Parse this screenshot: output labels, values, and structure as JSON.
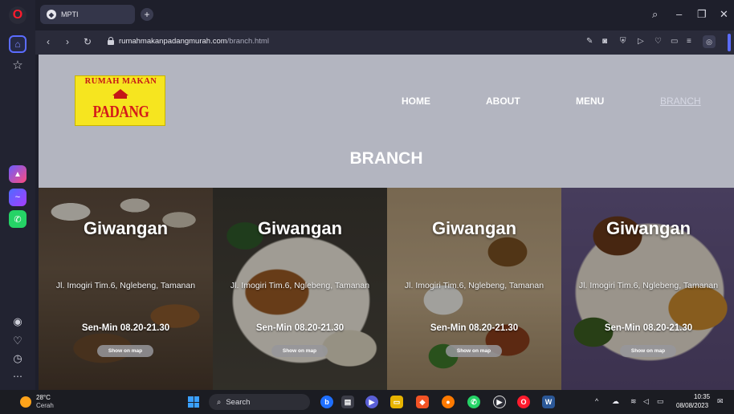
{
  "browser": {
    "tab": {
      "title": "MPTI"
    },
    "address": {
      "domain": "rumahmakanpadangmurah.com",
      "path": "/branch.html"
    }
  },
  "site": {
    "logo": {
      "top_text": "RUMAH MAKAN",
      "main_text": "PADANG MURAH"
    },
    "nav": [
      {
        "label": "HOME",
        "active": false
      },
      {
        "label": "ABOUT",
        "active": false
      },
      {
        "label": "MENU",
        "active": false
      },
      {
        "label": "BRANCH",
        "active": true
      }
    ],
    "page_title": "BRANCH",
    "branches": [
      {
        "name": "Giwangan",
        "address": "Jl. Imogiri Tim.6, Nglebeng, Tamanan",
        "hours": "Sen-Min 08.20-21.30",
        "button": "Show on map"
      },
      {
        "name": "Giwangan",
        "address": "Jl. Imogiri Tim.6, Nglebeng, Tamanan",
        "hours": "Sen-Min 08.20-21.30",
        "button": "Show on map"
      },
      {
        "name": "Giwangan",
        "address": "Jl. Imogiri Tim.6, Nglebeng, Tamanan",
        "hours": "Sen-Min 08.20-21.30",
        "button": "Show on map"
      },
      {
        "name": "Giwangan",
        "address": "Jl. Imogiri Tim.6, Nglebeng, Tamanan",
        "hours": "Sen-Min 08.20-21.30",
        "button": "Show on map"
      }
    ]
  },
  "taskbar": {
    "weather": {
      "temp": "28°C",
      "desc": "Cerah"
    },
    "search_label": "Search",
    "clock": {
      "time": "10:35",
      "date": "08/08/2023"
    }
  },
  "colors": {
    "header_bg": "#b3b5c0",
    "logo_bg": "#f6e51f",
    "logo_text": "#d41a1a",
    "accent": "#5b6cff"
  }
}
